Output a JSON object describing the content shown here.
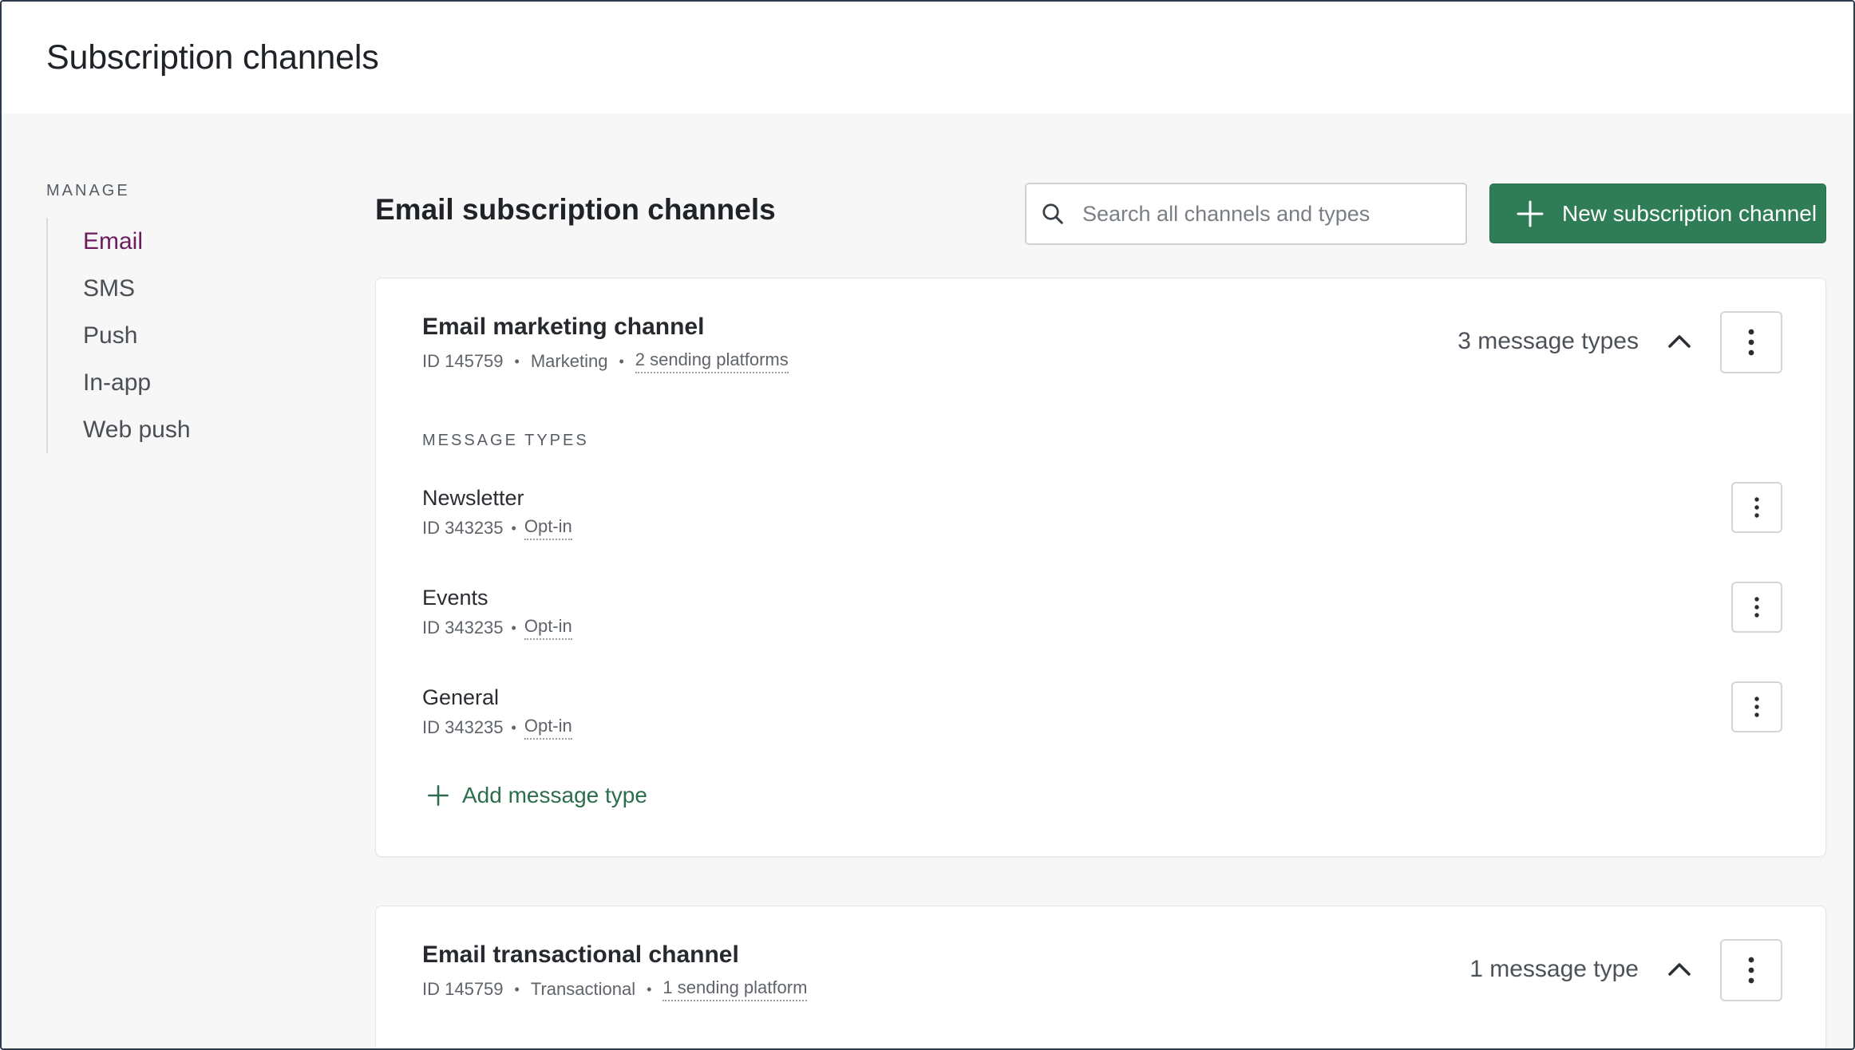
{
  "header": {
    "title": "Subscription channels"
  },
  "sidebar": {
    "heading": "MANAGE",
    "items": [
      {
        "label": "Email",
        "active": true
      },
      {
        "label": "SMS"
      },
      {
        "label": "Push"
      },
      {
        "label": "In-app"
      },
      {
        "label": "Web push"
      }
    ]
  },
  "main": {
    "heading": "Email subscription channels",
    "search": {
      "placeholder": "Search all channels and types",
      "value": ""
    },
    "new_button_label": "New subscription channel",
    "accent_color": "#2f7d56",
    "channels": [
      {
        "name": "Email marketing channel",
        "id": "ID 145759",
        "category": "Marketing",
        "platforms": "2 sending platforms",
        "count": "3 message types",
        "section_label": "MESSAGE TYPES",
        "message_types": [
          {
            "name": "Newsletter",
            "id": "ID 343235",
            "status": "Opt-in"
          },
          {
            "name": "Events",
            "id": "ID 343235",
            "status": "Opt-in"
          },
          {
            "name": "General",
            "id": "ID 343235",
            "status": "Opt-in"
          }
        ],
        "add_label": "Add message type"
      },
      {
        "name": "Email transactional channel",
        "id": "ID 145759",
        "category": "Transactional",
        "platforms": "1 sending platform",
        "count": "1 message type"
      }
    ]
  },
  "icons": {
    "search": "search-icon",
    "plus": "plus-icon",
    "chevron": "chevron-up-icon",
    "kebab": "more-vertical-icon"
  }
}
